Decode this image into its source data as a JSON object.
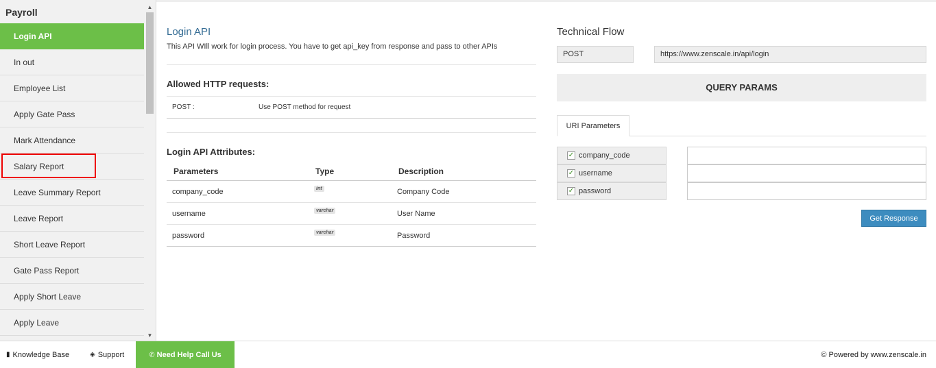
{
  "sidebar": {
    "title": "Payroll",
    "items": [
      {
        "label": "Login API"
      },
      {
        "label": "In out"
      },
      {
        "label": "Employee List"
      },
      {
        "label": "Apply Gate Pass"
      },
      {
        "label": "Mark Attendance"
      },
      {
        "label": "Salary Report"
      },
      {
        "label": "Leave Summary Report"
      },
      {
        "label": "Leave Report"
      },
      {
        "label": "Short Leave Report"
      },
      {
        "label": "Gate Pass Report"
      },
      {
        "label": "Apply Short Leave"
      },
      {
        "label": "Apply Leave"
      }
    ],
    "active_index": 0,
    "highlighted_item": "Salary Report"
  },
  "api": {
    "title": "Login API",
    "description": "This API WIll work for login process. You have to get api_key from response and pass to other APIs",
    "allowed_heading": "Allowed HTTP requests:",
    "request_method": "POST :",
    "request_desc": "Use POST method for request",
    "attributes_heading": "Login API Attributes:",
    "table_headers": [
      "Parameters",
      "Type",
      "Description"
    ],
    "attributes": [
      {
        "param": "company_code",
        "type": "int",
        "desc": "Company Code"
      },
      {
        "param": "username",
        "type": "varchar",
        "desc": "User Name"
      },
      {
        "param": "password",
        "type": "varchar",
        "desc": "Password"
      }
    ]
  },
  "flow": {
    "title": "Technical Flow",
    "method": "POST",
    "url": "https://www.zenscale.in/api/login",
    "query_params_label": "QUERY PARAMS",
    "tab_label": "URI Parameters",
    "params": [
      "company_code",
      "username",
      "password"
    ],
    "button_label": "Get Response"
  },
  "footer": {
    "knowledge_base": "Knowledge Base",
    "support": "Support",
    "help": "Need Help Call Us",
    "powered": "© Powered by www.zenscale.in"
  },
  "colors": {
    "accent_green": "#6cbf48",
    "link_blue": "#346c94",
    "button_blue": "#3d8cbf",
    "highlight_red": "#ee0000"
  }
}
